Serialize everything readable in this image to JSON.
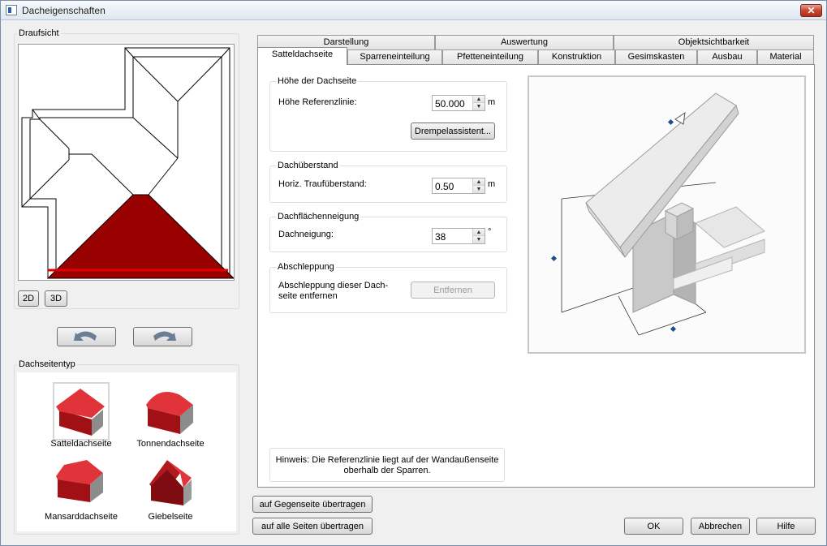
{
  "window": {
    "title": "Dacheigenschaften",
    "close_symbol": "✕"
  },
  "left": {
    "topview_label": "Draufsicht",
    "view_2d": "2D",
    "view_3d": "3D",
    "type_group_label": "Dachseitentyp",
    "roof_types": [
      {
        "label": "Satteldachseite",
        "selected": true,
        "color": "#d4272b"
      },
      {
        "label": "Tonnendachseite",
        "selected": false,
        "color": "#d4272b"
      },
      {
        "label": "Mansarddachseite",
        "selected": false,
        "color": "#d4272b"
      },
      {
        "label": "Giebelseite",
        "selected": false,
        "color": "#b31419"
      }
    ],
    "highlight_color": "#990000"
  },
  "tabs": {
    "row1": [
      "Darstellung",
      "Auswertung",
      "Objektsichtbarkeit"
    ],
    "row2": [
      "Satteldachseite",
      "Sparreneinteilung",
      "Pfetteneinteilung",
      "Konstruktion",
      "Gesimskasten",
      "Ausbau",
      "Material"
    ],
    "active": "Satteldachseite"
  },
  "panel": {
    "height_group": {
      "label": "Höhe der Dachseite",
      "field_label": "Höhe Referenzlinie:",
      "value": "50.000",
      "unit": "m",
      "button": "Drempelassistent..."
    },
    "overhang_group": {
      "label": "Dachüberstand",
      "field_label": "Horiz. Traufüberstand:",
      "value": "0.50",
      "unit": "m"
    },
    "pitch_group": {
      "label": "Dachflächenneigung",
      "field_label": "Dachneigung:",
      "value": "38",
      "unit": "°"
    },
    "drag_group": {
      "label": "Abschleppung",
      "text_line1": "Abschleppung dieser Dach-",
      "text_line2": "seite entfernen",
      "button": "Entfernen"
    },
    "hint_line1": "Hinweis: Die Referenzlinie liegt auf der Wandaußenseite",
    "hint_line2": "oberhalb der Sparren."
  },
  "footer": {
    "transfer_opposite": "auf Gegenseite übertragen",
    "transfer_all": "auf alle Seiten übertragen",
    "ok": "OK",
    "cancel": "Abbrechen",
    "help": "Hilfe"
  }
}
